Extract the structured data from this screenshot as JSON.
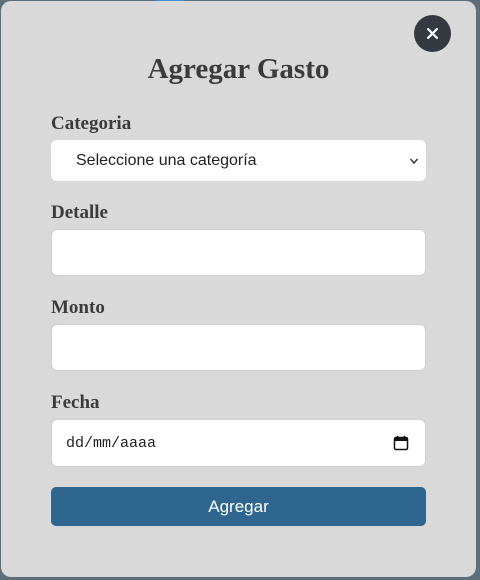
{
  "modal": {
    "title": "Agregar Gasto",
    "close_icon": "close-icon",
    "fields": {
      "categoria": {
        "label": "Categoria",
        "selected": "Seleccione una categoría"
      },
      "detalle": {
        "label": "Detalle",
        "value": ""
      },
      "monto": {
        "label": "Monto",
        "value": ""
      },
      "fecha": {
        "label": "Fecha",
        "placeholder": "dd/mm/aaaa",
        "icon": "calendar-icon"
      }
    },
    "submit_label": "Agregar"
  },
  "colors": {
    "modal_bg": "#d9d9d9",
    "close_bg": "#343a40",
    "submit_bg": "#2e6690",
    "text": "#3b3b3b"
  }
}
